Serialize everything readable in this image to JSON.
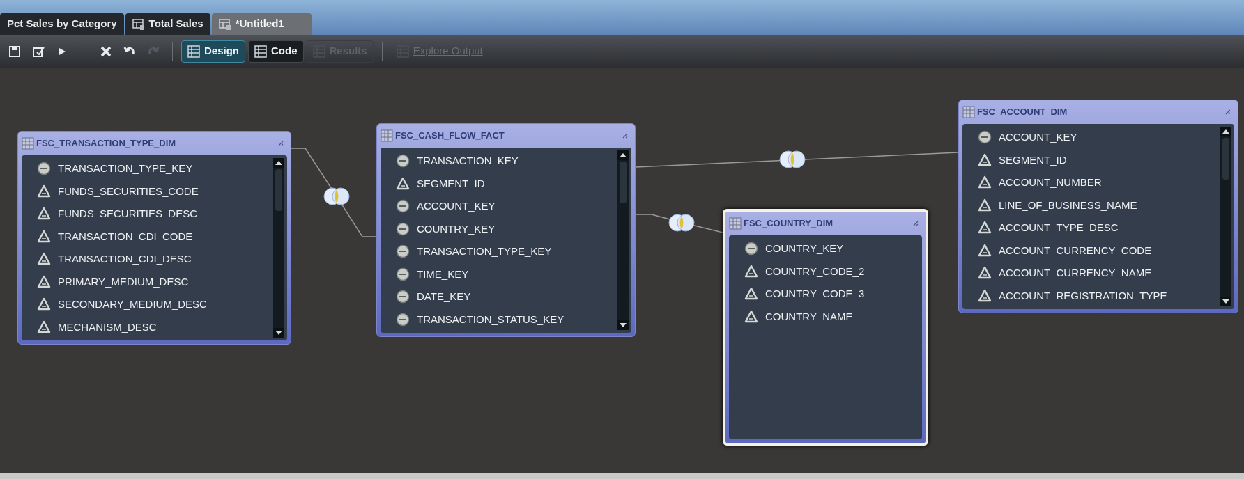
{
  "tabs": [
    {
      "label": "Pct Sales by Category",
      "selected": false,
      "kind": "plain"
    },
    {
      "label": "Total Sales",
      "selected": false,
      "kind": "query"
    },
    {
      "label": "*Untitled1",
      "selected": true,
      "kind": "query"
    }
  ],
  "toolbar": {
    "icon_buttons": [
      {
        "kind": "save",
        "disabled": false
      },
      {
        "kind": "edit",
        "disabled": false
      },
      {
        "kind": "run",
        "disabled": false
      },
      {
        "kind": "delete",
        "disabled": false
      },
      {
        "kind": "undo",
        "disabled": false
      },
      {
        "kind": "redo",
        "disabled": true
      }
    ],
    "view_buttons": [
      {
        "label": "Design",
        "kind": "design",
        "selected": true,
        "disabled": false
      },
      {
        "label": "Code",
        "kind": "code",
        "selected": false,
        "disabled": false
      },
      {
        "label": "Results",
        "kind": "results",
        "selected": false,
        "disabled": true
      },
      {
        "label": "Explore Output",
        "kind": "explore",
        "selected": false,
        "disabled": true
      }
    ]
  },
  "tables": [
    {
      "title": "FSC_TRANSACTION_TYPE_DIM",
      "selected": false,
      "columns": [
        {
          "name": "TRANSACTION_TYPE_KEY",
          "kind": "number"
        },
        {
          "name": "FUNDS_SECURITIES_CODE",
          "kind": "text"
        },
        {
          "name": "FUNDS_SECURITIES_DESC",
          "kind": "text"
        },
        {
          "name": "TRANSACTION_CDI_CODE",
          "kind": "text"
        },
        {
          "name": "TRANSACTION_CDI_DESC",
          "kind": "text"
        },
        {
          "name": "PRIMARY_MEDIUM_DESC",
          "kind": "text"
        },
        {
          "name": "SECONDARY_MEDIUM_DESC",
          "kind": "text"
        },
        {
          "name": "MECHANISM_DESC",
          "kind": "text"
        }
      ]
    },
    {
      "title": "FSC_CASH_FLOW_FACT",
      "selected": false,
      "columns": [
        {
          "name": "TRANSACTION_KEY",
          "kind": "number"
        },
        {
          "name": "SEGMENT_ID",
          "kind": "text"
        },
        {
          "name": "ACCOUNT_KEY",
          "kind": "number"
        },
        {
          "name": "COUNTRY_KEY",
          "kind": "number"
        },
        {
          "name": "TRANSACTION_TYPE_KEY",
          "kind": "number"
        },
        {
          "name": "TIME_KEY",
          "kind": "number"
        },
        {
          "name": "DATE_KEY",
          "kind": "number"
        },
        {
          "name": "TRANSACTION_STATUS_KEY",
          "kind": "number"
        }
      ]
    },
    {
      "title": "FSC_COUNTRY_DIM",
      "selected": true,
      "columns": [
        {
          "name": "COUNTRY_KEY",
          "kind": "number"
        },
        {
          "name": "COUNTRY_CODE_2",
          "kind": "text"
        },
        {
          "name": "COUNTRY_CODE_3",
          "kind": "text"
        },
        {
          "name": "COUNTRY_NAME",
          "kind": "text"
        }
      ]
    },
    {
      "title": "FSC_ACCOUNT_DIM",
      "selected": false,
      "columns": [
        {
          "name": "ACCOUNT_KEY",
          "kind": "number"
        },
        {
          "name": "SEGMENT_ID",
          "kind": "text"
        },
        {
          "name": "ACCOUNT_NUMBER",
          "kind": "text"
        },
        {
          "name": "LINE_OF_BUSINESS_NAME",
          "kind": "text"
        },
        {
          "name": "ACCOUNT_TYPE_DESC",
          "kind": "text"
        },
        {
          "name": "ACCOUNT_CURRENCY_CODE",
          "kind": "text"
        },
        {
          "name": "ACCOUNT_CURRENCY_NAME",
          "kind": "text"
        },
        {
          "name": "ACCOUNT_REGISTRATION_TYPE_",
          "kind": "text"
        }
      ]
    }
  ]
}
